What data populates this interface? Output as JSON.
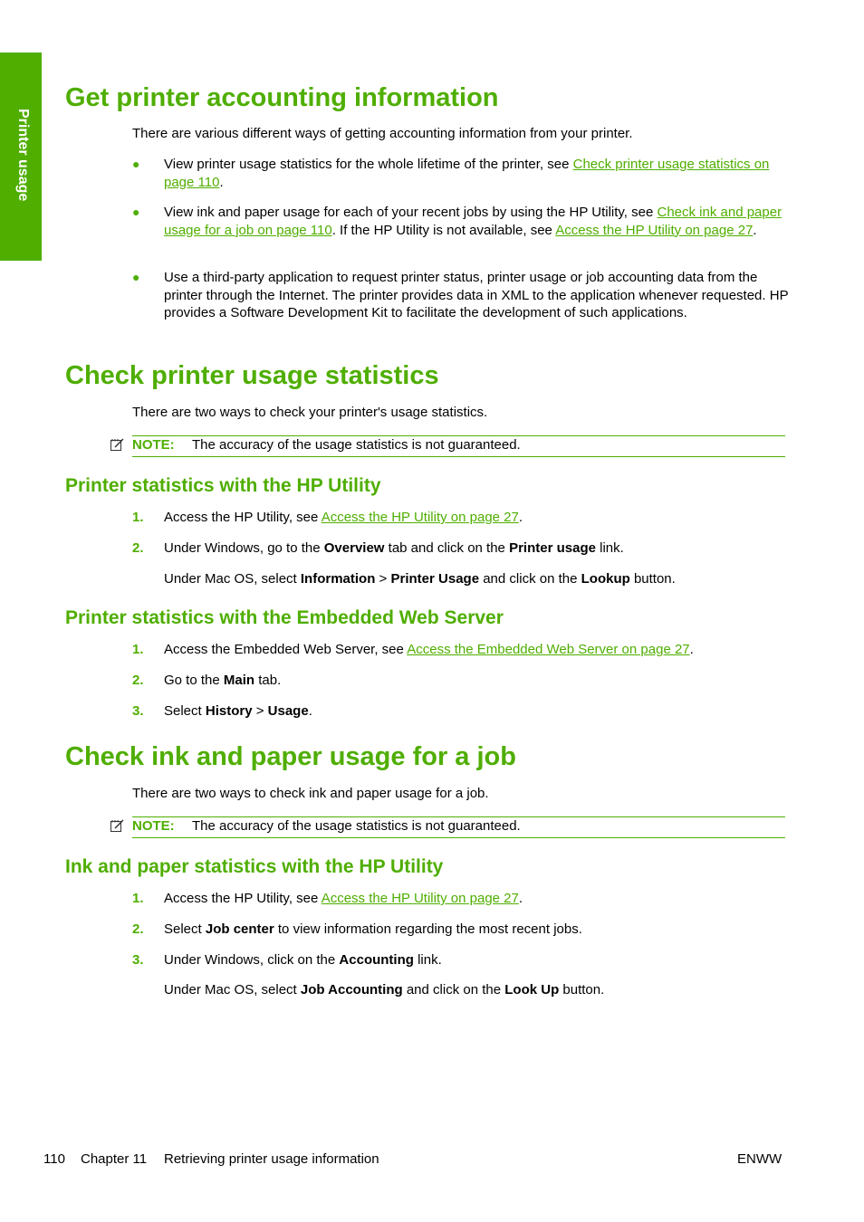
{
  "side_tab": {
    "label": "Printer usage"
  },
  "colors": {
    "accent": "#4fae00"
  },
  "sections": {
    "s1": {
      "title": "Get printer accounting information",
      "intro": "There are various different ways of getting accounting information from your printer.",
      "bullets": [
        {
          "pre": "View printer usage statistics for the whole lifetime of the printer, see ",
          "link": "Check printer usage statistics on page 110",
          "post": "."
        },
        {
          "pre": "View ink and paper usage for each of your recent jobs by using the HP Utility, see ",
          "link": "Check ink and paper usage for a job on page 110",
          "mid": ". If the HP Utility is not available, see ",
          "link2": "Access the HP Utility on page 27",
          "post": "."
        },
        {
          "text": "Use a third-party application to request printer status, printer usage or job accounting data from the printer through the Internet. The printer provides data in XML to the application whenever requested. HP provides a Software Development Kit to facilitate the development of such applications."
        }
      ]
    },
    "s2": {
      "title": "Check printer usage statistics",
      "intro": "There are two ways to check your printer's usage statistics.",
      "note_label": "NOTE:",
      "note_text": "The accuracy of the usage statistics is not guaranteed.",
      "sub1": {
        "title": "Printer statistics with the HP Utility",
        "steps": [
          {
            "num": "1.",
            "pre": "Access the HP Utility, see ",
            "link": "Access the HP Utility on page 27",
            "post": "."
          },
          {
            "num": "2.",
            "t1": "Under Windows, go to the ",
            "b1": "Overview",
            "t2": " tab and click on the ",
            "b2": "Printer usage",
            "t3": " link."
          }
        ],
        "mac": {
          "t1": "Under Mac OS, select ",
          "b1": "Information",
          "t2": " > ",
          "b2": "Printer Usage",
          "t3": " and click on the ",
          "b3": "Lookup",
          "t4": " button."
        }
      },
      "sub2": {
        "title": "Printer statistics with the Embedded Web Server",
        "steps": [
          {
            "num": "1.",
            "pre": "Access the Embedded Web Server, see ",
            "link": "Access the Embedded Web Server on page 27",
            "post": "."
          },
          {
            "num": "2.",
            "t1": "Go to the ",
            "b1": "Main",
            "t2": " tab."
          },
          {
            "num": "3.",
            "t1": "Select ",
            "b1": "History",
            "t2": " > ",
            "b2": "Usage",
            "t3": "."
          }
        ]
      }
    },
    "s3": {
      "title": "Check ink and paper usage for a job",
      "intro": "There are two ways to check ink and paper usage for a job.",
      "note_label": "NOTE:",
      "note_text": "The accuracy of the usage statistics is not guaranteed.",
      "sub1": {
        "title": "Ink and paper statistics with the HP Utility",
        "steps": [
          {
            "num": "1.",
            "pre": "Access the HP Utility, see ",
            "link": "Access the HP Utility on page 27",
            "post": "."
          },
          {
            "num": "2.",
            "t1": "Select ",
            "b1": "Job center",
            "t2": " to view information regarding the most recent jobs."
          },
          {
            "num": "3.",
            "t1": "Under Windows, click on the ",
            "b1": "Accounting",
            "t2": " link."
          }
        ],
        "mac": {
          "t1": "Under Mac OS, select ",
          "b1": "Job Accounting",
          "t2": " and click on the ",
          "b2": "Look Up",
          "t3": " button."
        }
      }
    }
  },
  "footer": {
    "page": "110",
    "chapter": "Chapter 11",
    "chapter_title": "Retrieving printer usage information",
    "right": "ENWW"
  }
}
